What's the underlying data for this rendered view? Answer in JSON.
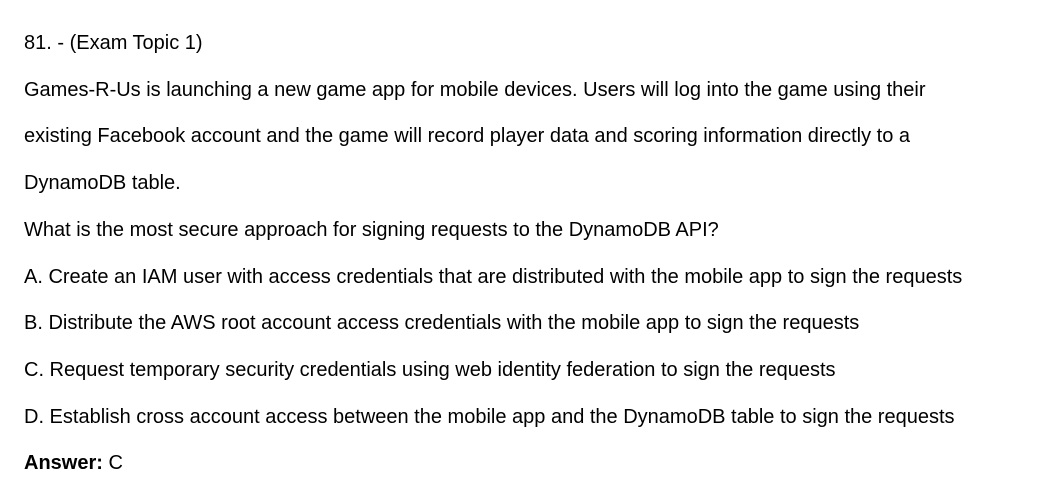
{
  "question": {
    "header": "81. - (Exam Topic 1)",
    "body_lines": [
      "Games-R-Us is launching a new game app for mobile devices. Users will log into the game using their",
      "existing Facebook account and the game will record player data and scoring information directly to a",
      "DynamoDB table."
    ],
    "prompt": "What is the most secure approach for signing requests to the DynamoDB API?",
    "options": [
      "A. Create an IAM user with access credentials that are distributed with the mobile app to sign the requests",
      "B. Distribute the AWS root account access credentials with the mobile app to sign the requests",
      "C. Request temporary security credentials using web identity federation to sign the requests",
      "D. Establish cross account access between the mobile app and the DynamoDB table to sign the requests"
    ],
    "answer_label": "Answer:",
    "answer_value": " C"
  }
}
